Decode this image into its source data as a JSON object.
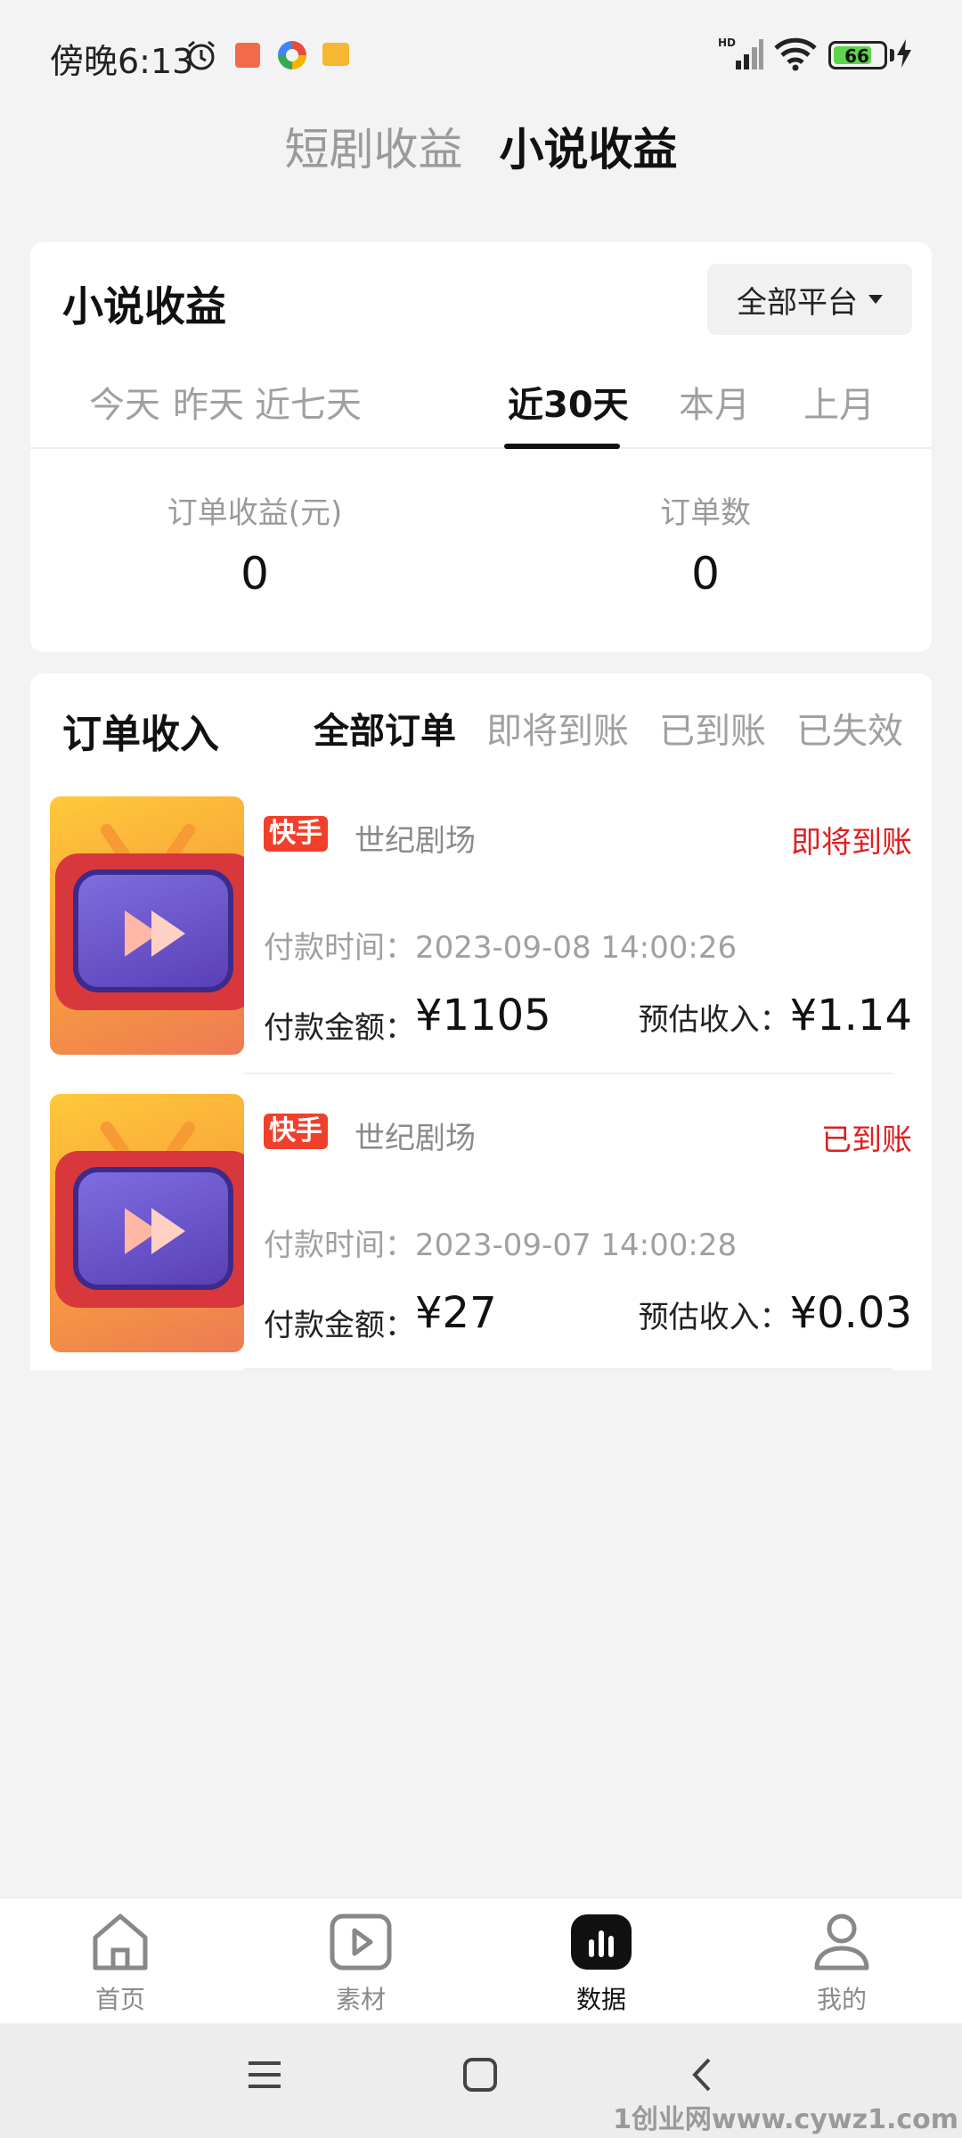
{
  "status_bar": {
    "time": "傍晚6:13",
    "battery": "66"
  },
  "top_tabs": [
    {
      "label": "短剧收益",
      "active": false
    },
    {
      "label": "小说收益",
      "active": true
    }
  ],
  "summary": {
    "title": "小说收益",
    "platform_select": "全部平台",
    "periods": [
      "今天",
      "昨天",
      "近七天",
      "近30天",
      "本月",
      "上月"
    ],
    "active_period": "近30天",
    "stats": [
      {
        "label": "订单收益(元)",
        "value": "0"
      },
      {
        "label": "订单数",
        "value": "0"
      }
    ]
  },
  "orders_section": {
    "title": "订单收入",
    "filters": [
      "全部订单",
      "即将到账",
      "已到账",
      "已失效"
    ],
    "active_filter": "全部订单",
    "orders": [
      {
        "platform_badge": "快手",
        "source": "世纪剧场",
        "status": "即将到账",
        "pay_time_label": "付款时间：",
        "pay_time": "2023-09-08 14:00:26",
        "amount_label": "付款金额：",
        "amount": "¥1105",
        "estimate_label": "预估收入：",
        "estimate": "¥1.14"
      },
      {
        "platform_badge": "快手",
        "source": "世纪剧场",
        "status": "已到账",
        "pay_time_label": "付款时间：",
        "pay_time": "2023-09-07 14:00:28",
        "amount_label": "付款金额：",
        "amount": "¥27",
        "estimate_label": "预估收入：",
        "estimate": "¥0.03"
      }
    ]
  },
  "bottom_nav": [
    {
      "label": "首页",
      "icon": "home-icon"
    },
    {
      "label": "素材",
      "icon": "play-icon"
    },
    {
      "label": "数据",
      "icon": "bar-chart-icon",
      "active": true
    },
    {
      "label": "我的",
      "icon": "user-icon"
    }
  ],
  "watermark": "1创业网www.cywz1.com",
  "colors": {
    "accent_red": "#e02020",
    "badge_red": "#f0402b",
    "active_text": "#111111"
  }
}
